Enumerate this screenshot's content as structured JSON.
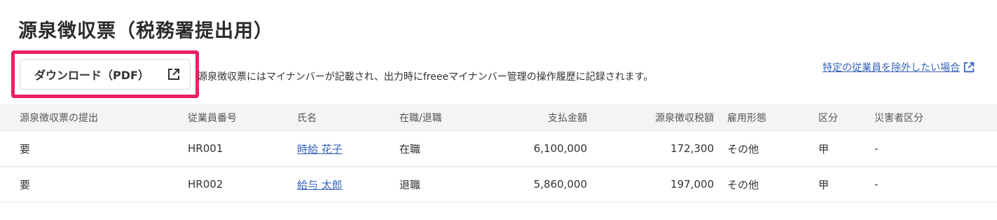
{
  "page": {
    "title": "源泉徴収票（税務署提出用）"
  },
  "toolbar": {
    "download_label": "ダウンロード（PDF）",
    "download_icon": "open-external-icon",
    "notice": "源泉徴収票にはマイナンバーが記載され、出力時にfreeeマイナンバー管理の操作履歴に記録されます。",
    "exclude_link_label": "特定の従業員を除外したい場合",
    "exclude_link_icon": "open-external-icon",
    "highlight_color": "#ec1f66",
    "link_color": "#3562b8"
  },
  "table": {
    "headers": {
      "submission": "源泉徴収票の提出",
      "employee_no": "従業員番号",
      "name": "氏名",
      "status": "在職/退職",
      "payment": "支払金額",
      "tax": "源泉徴収税額",
      "employment_type": "雇用形態",
      "category": "区分",
      "disaster": "災害者区分"
    },
    "rows": [
      {
        "submission": "要",
        "employee_no": "HR001",
        "name": "時給 花子",
        "status": "在職",
        "payment": "6,100,000",
        "tax": "172,300",
        "employment_type": "その他",
        "category": "甲",
        "disaster": "-"
      },
      {
        "submission": "要",
        "employee_no": "HR002",
        "name": "給与 太郎",
        "status": "退職",
        "payment": "5,860,000",
        "tax": "197,000",
        "employment_type": "その他",
        "category": "甲",
        "disaster": "-"
      }
    ]
  }
}
